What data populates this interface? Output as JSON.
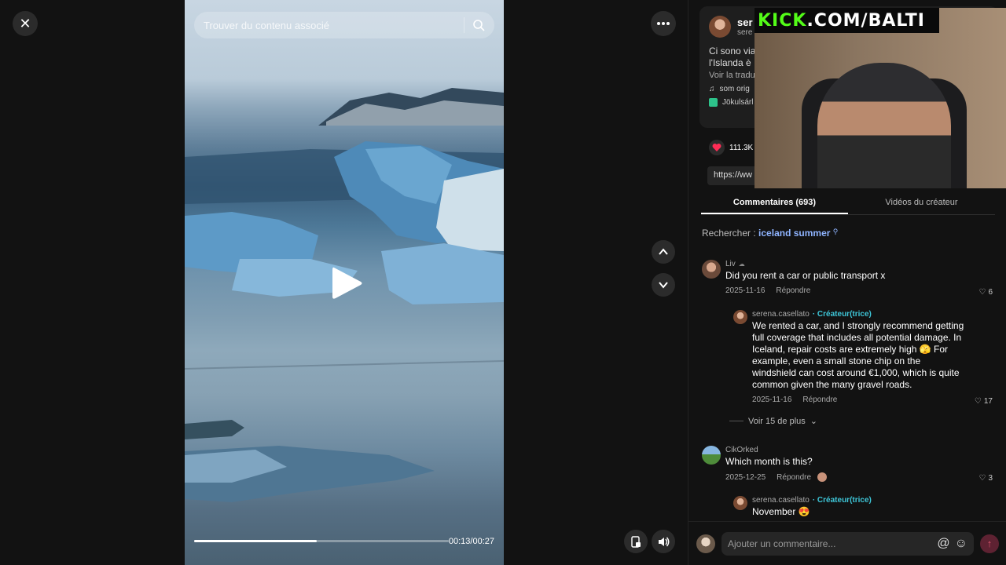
{
  "video": {
    "search_placeholder": "Trouver du contenu associé",
    "time": "00:13/00:27",
    "progress": 0.48
  },
  "post": {
    "author_name": "ser",
    "author_handle": "sere",
    "caption_line1": "Ci sono via",
    "caption_line2": "l'Islanda è",
    "translate": "Voir la tradu",
    "music": "som orig",
    "place": "Jökulsárl",
    "likes": "111.3K",
    "url": "https://ww"
  },
  "tabs": [
    {
      "label": "Commentaires (693)",
      "active": true
    },
    {
      "label": "Vidéos du créateur",
      "active": false
    }
  ],
  "related_search": {
    "prefix": "Rechercher :",
    "keyword": "iceland summer"
  },
  "comments": [
    {
      "user": "Liv",
      "text": "Did you rent a car or public transport x",
      "date": "2025-11-16",
      "reply": "Répondre",
      "likes": "6"
    },
    {
      "user": "serena.casellato",
      "creator": "· Créateur(trice)",
      "text": "We rented a car, and I strongly recommend getting full coverage that includes all potential damage. In Iceland, repair costs are extremely high 🫣 For example, even a small stone chip on the windshield can cost around €1,000, which is quite common given the many gravel roads.",
      "date": "2025-11-16",
      "reply": "Répondre",
      "likes": "17"
    },
    {
      "user": "CikOrked",
      "text": "Which month is this?",
      "date": "2025-12-25",
      "reply": "Répondre",
      "likes": "3"
    },
    {
      "user": "serena.casellato",
      "creator": "· Créateur(trice)",
      "text": "November 😍"
    }
  ],
  "more_replies": "Voir 15 de plus",
  "composer": {
    "placeholder": "Ajouter un commentaire..."
  },
  "overlay": {
    "brand_green": "KICK",
    "brand_white": ".COM/BALTI"
  },
  "colors": {
    "accent": "#fe2c55",
    "creator": "#3ec6d8",
    "kick": "#53fc18",
    "keyword": "#8fb4ff"
  }
}
